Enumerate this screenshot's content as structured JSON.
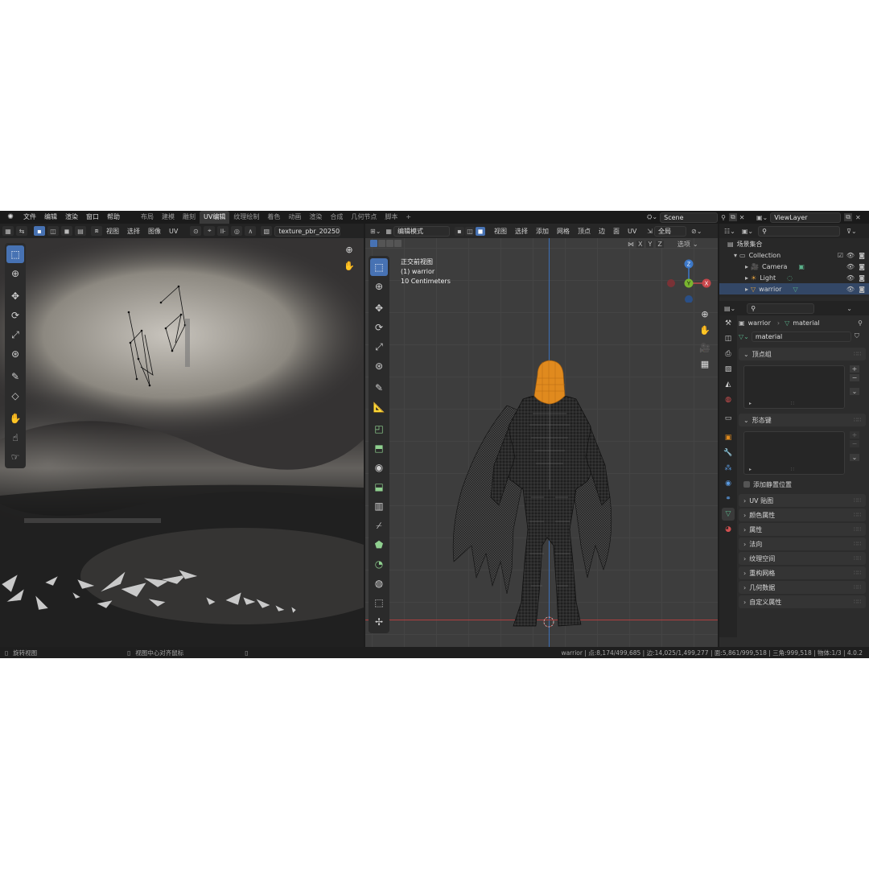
{
  "menu": [
    "文件",
    "编辑",
    "渲染",
    "窗口",
    "帮助"
  ],
  "workspaces": [
    {
      "label": "布局",
      "active": false
    },
    {
      "label": "建模",
      "active": false
    },
    {
      "label": "雕刻",
      "active": false
    },
    {
      "label": "UV编辑",
      "active": true
    },
    {
      "label": "纹理绘制",
      "active": false
    },
    {
      "label": "着色",
      "active": false
    },
    {
      "label": "动画",
      "active": false
    },
    {
      "label": "渲染",
      "active": false
    },
    {
      "label": "合成",
      "active": false
    },
    {
      "label": "几何节点",
      "active": false
    },
    {
      "label": "脚本",
      "active": false
    }
  ],
  "add_workspace": "+",
  "scene_name": "Scene",
  "view_layer": "ViewLayer",
  "uv_editor": {
    "menus": [
      "视图",
      "选择",
      "图像",
      "UV"
    ],
    "image_name": "texture_pbr_20250"
  },
  "viewport": {
    "mode": "编辑模式",
    "menus": [
      "视图",
      "选择",
      "添加",
      "网格",
      "顶点",
      "边",
      "面",
      "UV"
    ],
    "transform": "全局",
    "axes": [
      "X",
      "Y",
      "Z"
    ],
    "options": "选项",
    "info": {
      "view": "正交前视图",
      "object": "(1) warrior",
      "scale": "10 Centimeters"
    },
    "gizmo": {
      "x": "X",
      "y": "Y",
      "z": "Z"
    }
  },
  "outliner": {
    "root": "场景集合",
    "collection": "Collection",
    "items": [
      "Camera",
      "Light",
      "warrior"
    ]
  },
  "properties": {
    "breadcrumb_object": "warrior",
    "breadcrumb_data": "material",
    "mesh_name": "material",
    "vertex_groups": "顶点组",
    "shape_keys": "形态键",
    "add_rest_position": "添加静置位置",
    "panels": [
      "UV 贴图",
      "颜色属性",
      "属性",
      "法向",
      "纹理空间",
      "重构网格",
      "几何数据",
      "自定义属性"
    ]
  },
  "status": {
    "left": "旋转视图",
    "middle": "视图中心对齐鼠标",
    "stats": "warrior | 点:8,174/499,685 | 边:14,025/1,499,277 | 面:5,861/999,518 | 三角:999,518 | 物体:1/3 | 4.0.2"
  },
  "colors": {
    "accent": "#4772b3",
    "selected_mesh": "#e08a1e",
    "axis_x": "#c8464b",
    "axis_y": "#7ab530",
    "axis_z": "#3c78c8"
  }
}
